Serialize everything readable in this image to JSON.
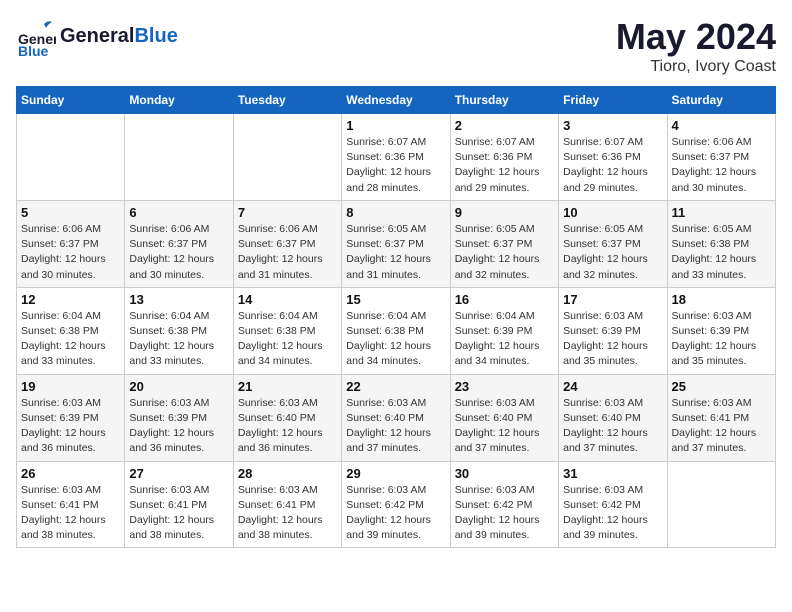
{
  "header": {
    "logo_general": "General",
    "logo_blue": "Blue",
    "month": "May 2024",
    "location": "Tioro, Ivory Coast"
  },
  "weekdays": [
    "Sunday",
    "Monday",
    "Tuesday",
    "Wednesday",
    "Thursday",
    "Friday",
    "Saturday"
  ],
  "weeks": [
    [
      {
        "day": "",
        "info": ""
      },
      {
        "day": "",
        "info": ""
      },
      {
        "day": "",
        "info": ""
      },
      {
        "day": "1",
        "info": "Sunrise: 6:07 AM\nSunset: 6:36 PM\nDaylight: 12 hours\nand 28 minutes."
      },
      {
        "day": "2",
        "info": "Sunrise: 6:07 AM\nSunset: 6:36 PM\nDaylight: 12 hours\nand 29 minutes."
      },
      {
        "day": "3",
        "info": "Sunrise: 6:07 AM\nSunset: 6:36 PM\nDaylight: 12 hours\nand 29 minutes."
      },
      {
        "day": "4",
        "info": "Sunrise: 6:06 AM\nSunset: 6:37 PM\nDaylight: 12 hours\nand 30 minutes."
      }
    ],
    [
      {
        "day": "5",
        "info": "Sunrise: 6:06 AM\nSunset: 6:37 PM\nDaylight: 12 hours\nand 30 minutes."
      },
      {
        "day": "6",
        "info": "Sunrise: 6:06 AM\nSunset: 6:37 PM\nDaylight: 12 hours\nand 30 minutes."
      },
      {
        "day": "7",
        "info": "Sunrise: 6:06 AM\nSunset: 6:37 PM\nDaylight: 12 hours\nand 31 minutes."
      },
      {
        "day": "8",
        "info": "Sunrise: 6:05 AM\nSunset: 6:37 PM\nDaylight: 12 hours\nand 31 minutes."
      },
      {
        "day": "9",
        "info": "Sunrise: 6:05 AM\nSunset: 6:37 PM\nDaylight: 12 hours\nand 32 minutes."
      },
      {
        "day": "10",
        "info": "Sunrise: 6:05 AM\nSunset: 6:37 PM\nDaylight: 12 hours\nand 32 minutes."
      },
      {
        "day": "11",
        "info": "Sunrise: 6:05 AM\nSunset: 6:38 PM\nDaylight: 12 hours\nand 33 minutes."
      }
    ],
    [
      {
        "day": "12",
        "info": "Sunrise: 6:04 AM\nSunset: 6:38 PM\nDaylight: 12 hours\nand 33 minutes."
      },
      {
        "day": "13",
        "info": "Sunrise: 6:04 AM\nSunset: 6:38 PM\nDaylight: 12 hours\nand 33 minutes."
      },
      {
        "day": "14",
        "info": "Sunrise: 6:04 AM\nSunset: 6:38 PM\nDaylight: 12 hours\nand 34 minutes."
      },
      {
        "day": "15",
        "info": "Sunrise: 6:04 AM\nSunset: 6:38 PM\nDaylight: 12 hours\nand 34 minutes."
      },
      {
        "day": "16",
        "info": "Sunrise: 6:04 AM\nSunset: 6:39 PM\nDaylight: 12 hours\nand 34 minutes."
      },
      {
        "day": "17",
        "info": "Sunrise: 6:03 AM\nSunset: 6:39 PM\nDaylight: 12 hours\nand 35 minutes."
      },
      {
        "day": "18",
        "info": "Sunrise: 6:03 AM\nSunset: 6:39 PM\nDaylight: 12 hours\nand 35 minutes."
      }
    ],
    [
      {
        "day": "19",
        "info": "Sunrise: 6:03 AM\nSunset: 6:39 PM\nDaylight: 12 hours\nand 36 minutes."
      },
      {
        "day": "20",
        "info": "Sunrise: 6:03 AM\nSunset: 6:39 PM\nDaylight: 12 hours\nand 36 minutes."
      },
      {
        "day": "21",
        "info": "Sunrise: 6:03 AM\nSunset: 6:40 PM\nDaylight: 12 hours\nand 36 minutes."
      },
      {
        "day": "22",
        "info": "Sunrise: 6:03 AM\nSunset: 6:40 PM\nDaylight: 12 hours\nand 37 minutes."
      },
      {
        "day": "23",
        "info": "Sunrise: 6:03 AM\nSunset: 6:40 PM\nDaylight: 12 hours\nand 37 minutes."
      },
      {
        "day": "24",
        "info": "Sunrise: 6:03 AM\nSunset: 6:40 PM\nDaylight: 12 hours\nand 37 minutes."
      },
      {
        "day": "25",
        "info": "Sunrise: 6:03 AM\nSunset: 6:41 PM\nDaylight: 12 hours\nand 37 minutes."
      }
    ],
    [
      {
        "day": "26",
        "info": "Sunrise: 6:03 AM\nSunset: 6:41 PM\nDaylight: 12 hours\nand 38 minutes."
      },
      {
        "day": "27",
        "info": "Sunrise: 6:03 AM\nSunset: 6:41 PM\nDaylight: 12 hours\nand 38 minutes."
      },
      {
        "day": "28",
        "info": "Sunrise: 6:03 AM\nSunset: 6:41 PM\nDaylight: 12 hours\nand 38 minutes."
      },
      {
        "day": "29",
        "info": "Sunrise: 6:03 AM\nSunset: 6:42 PM\nDaylight: 12 hours\nand 39 minutes."
      },
      {
        "day": "30",
        "info": "Sunrise: 6:03 AM\nSunset: 6:42 PM\nDaylight: 12 hours\nand 39 minutes."
      },
      {
        "day": "31",
        "info": "Sunrise: 6:03 AM\nSunset: 6:42 PM\nDaylight: 12 hours\nand 39 minutes."
      },
      {
        "day": "",
        "info": ""
      }
    ]
  ]
}
